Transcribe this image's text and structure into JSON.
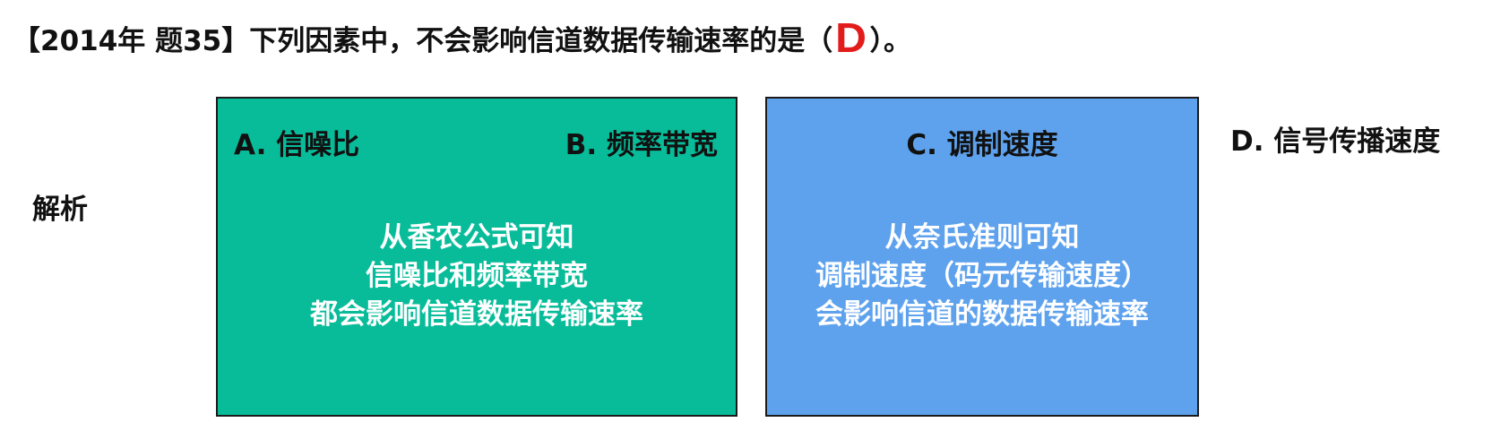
{
  "question": {
    "prefix": "【2014年 题35】下列因素中，不会影响信道数据传输速率的是（",
    "answer": "D",
    "suffix": "）。"
  },
  "analysis_label": "解析",
  "options": {
    "a": "A. 信噪比",
    "b": "B. 频率带宽",
    "c": "C. 调制速度",
    "d": "D. 信号传播速度"
  },
  "panels": {
    "green": {
      "lines": [
        "从香农公式可知",
        "信噪比和频率带宽",
        "都会影响信道数据传输速率"
      ]
    },
    "blue": {
      "lines": [
        "从奈氏准则可知",
        "调制速度（码元传输速度）",
        "会影响信道的数据传输速率"
      ]
    }
  },
  "colors": {
    "green_panel": "#08bc9a",
    "blue_panel": "#5ea2ee",
    "answer": "#e21b1b",
    "text": "#111111"
  }
}
